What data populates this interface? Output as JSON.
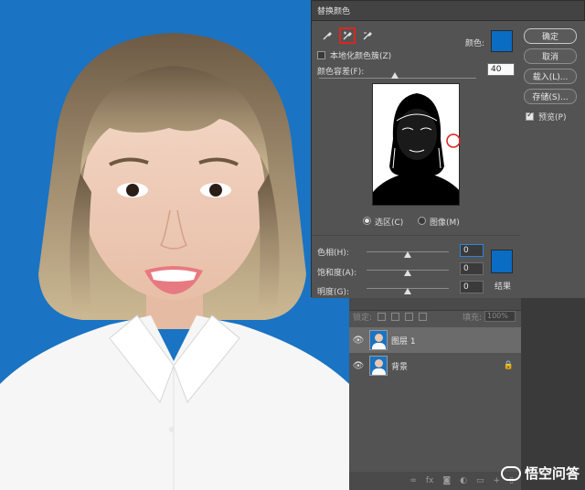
{
  "dialog": {
    "title": "替换颜色",
    "localized_clusters_label": "本地化颜色簇(Z)",
    "color_label": "颜色:",
    "fuzziness_label": "颜色容差(F):",
    "fuzziness_value": "40",
    "selection_radio": "选区(C)",
    "image_radio": "图像(M)",
    "hue_label": "色相(H):",
    "hue_value": "0",
    "saturation_label": "饱和度(A):",
    "saturation_value": "0",
    "lightness_label": "明度(G):",
    "lightness_value": "0",
    "result_label": "结果",
    "ok_button": "确定",
    "cancel_button": "取消",
    "load_button": "载入(L)...",
    "save_button": "存储(S)...",
    "preview_label": "预览(P)",
    "accent_color": "#0a6cc2"
  },
  "layers": {
    "lock_label": "锁定:",
    "fill_label": "填充:",
    "fill_value": "100%",
    "items": [
      {
        "name": "图层 1",
        "selected": true
      },
      {
        "name": "背景",
        "selected": false
      }
    ]
  },
  "watermark": {
    "text": "悟空问答"
  }
}
